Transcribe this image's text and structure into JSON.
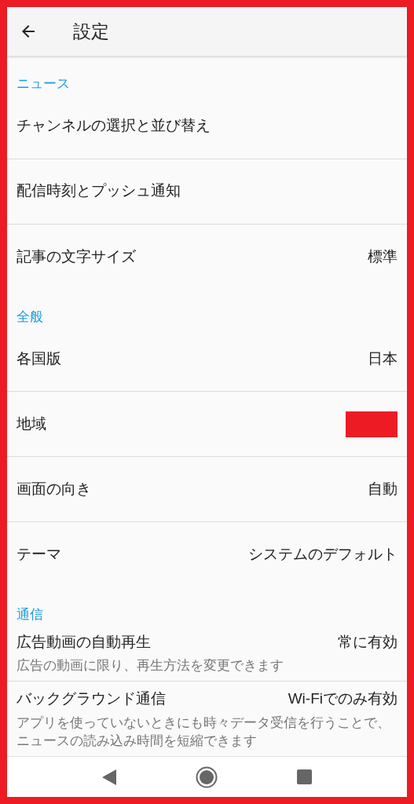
{
  "header": {
    "title": "設定"
  },
  "sections": [
    {
      "title": "ニュース",
      "items": [
        {
          "label": "チャンネルの選択と並び替え"
        },
        {
          "label": "配信時刻とプッシュ通知"
        },
        {
          "label": "記事の文字サイズ",
          "value": "標準"
        }
      ]
    },
    {
      "title": "全般",
      "items": [
        {
          "label": "各国版",
          "value": "日本"
        },
        {
          "label": "地域",
          "redacted": true
        },
        {
          "label": "画面の向き",
          "value": "自動"
        },
        {
          "label": "テーマ",
          "value": "システムのデフォルト"
        }
      ]
    },
    {
      "title": "通信",
      "items": [
        {
          "label": "広告動画の自動再生",
          "value": "常に有効",
          "description": "広告の動画に限り、再生方法を変更できます"
        },
        {
          "label": "バックグラウンド通信",
          "value": "Wi-Fiでのみ有効",
          "description": "アプリを使っていないときにも時々データ受信を行うことで、ニュースの読み込み時間を短縮できます"
        }
      ]
    }
  ]
}
